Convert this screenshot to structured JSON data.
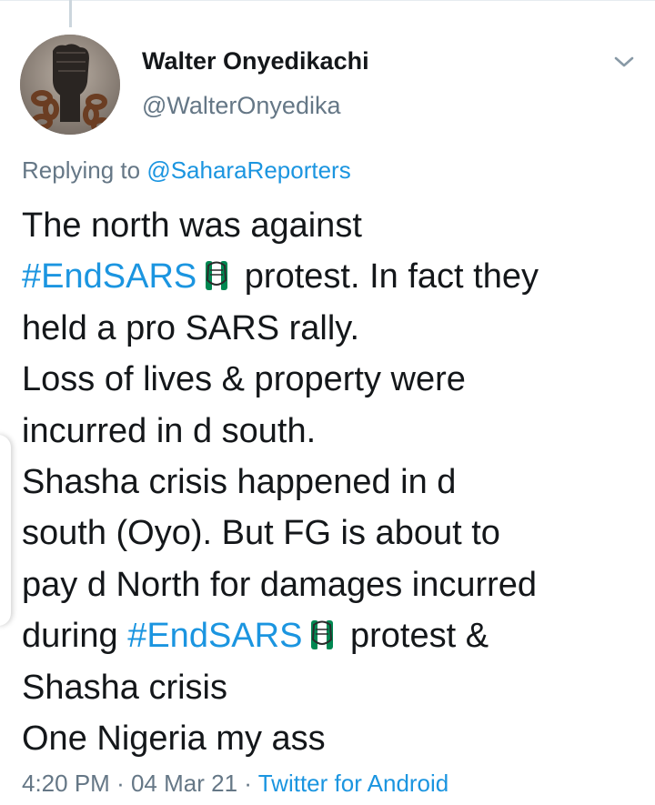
{
  "tweet": {
    "author_name": "Walter Onyedikachi",
    "author_handle": "@WalterOnyedika",
    "reply_prefix": "Replying to",
    "reply_to": "@SaharaReporters",
    "lines": [
      {
        "text": "The north was against"
      },
      {
        "hashtag": "#EndSARS",
        "emoji": "raised-fist-green-white",
        "text": " protest. In fact they"
      },
      {
        "text": "held a pro SARS rally."
      },
      {
        "text": "Loss of lives &  property were"
      },
      {
        "text": "incurred in d south."
      },
      {
        "text": "Shasha crisis happened in d"
      },
      {
        "text": "south (Oyo). But FG  is about to"
      },
      {
        "text": "pay d North for damages incurred"
      },
      {
        "prefix": "during ",
        "hashtag": "#EndSARS",
        "emoji": "raised-fist-green-white",
        "text": " protest &"
      },
      {
        "text": "Shasha crisis"
      },
      {
        "text": "One Nigeria my ass"
      }
    ],
    "time": "4:20 PM",
    "date": "04 Mar 21",
    "separator": "·",
    "source": "Twitter for Android"
  },
  "icons": {
    "more": "chevron-down-icon",
    "hashtag_emoji": "raised-fist-icon"
  },
  "colors": {
    "link": "#1b95e0",
    "secondary_text": "#657786",
    "primary_text": "#14171a",
    "emoji_green": "#008751"
  }
}
